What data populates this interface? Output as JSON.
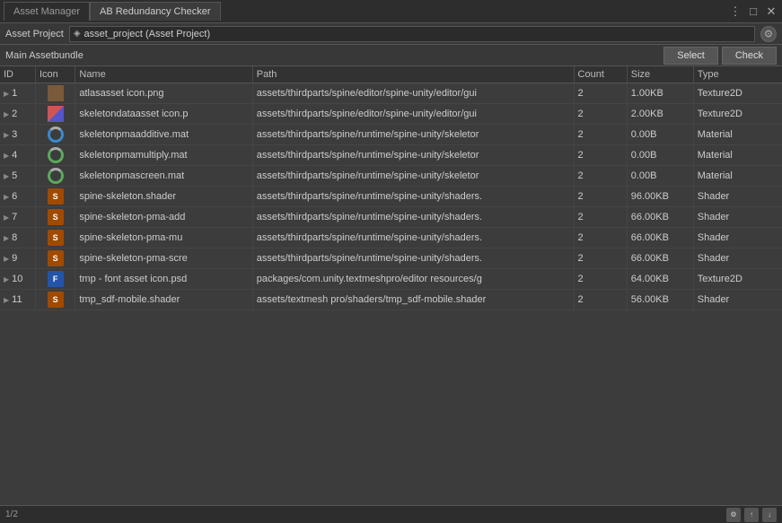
{
  "titleBar": {
    "tabs": [
      {
        "label": "Asset Manager",
        "active": false
      },
      {
        "label": "AB Redundancy Checker",
        "active": true
      }
    ],
    "controls": [
      "⋮",
      "□",
      "✕"
    ]
  },
  "secondBar": {
    "label": "Asset Project",
    "field": "asset_project (Asset Project)",
    "icon": "◈"
  },
  "thirdBar": {
    "label": "Main Assetbundle",
    "selectBtn": "Select",
    "checkBtn": "Check"
  },
  "table": {
    "headers": [
      "ID",
      "Icon",
      "Name",
      "Path",
      "Count",
      "Size",
      "Type"
    ],
    "rows": [
      {
        "id": 1,
        "iconClass": "icon-atlas",
        "iconText": "",
        "name": "atlasasset icon.png",
        "path": "assets/thirdparts/spine/editor/spine-unity/editor/gui",
        "count": 2,
        "size": "1.00KB",
        "type": "Texture2D"
      },
      {
        "id": 2,
        "iconClass": "icon-skeleton",
        "iconText": "",
        "name": "skeletondataasset icon.p",
        "path": "assets/thirdparts/spine/editor/spine-unity/editor/gui",
        "count": 2,
        "size": "2.00KB",
        "type": "Texture2D"
      },
      {
        "id": 3,
        "iconClass": "icon-spinner",
        "iconText": "",
        "name": "skeletonpmaadditive.mat",
        "path": "assets/thirdparts/spine/runtime/spine-unity/skeletor",
        "count": 2,
        "size": "0.00B",
        "type": "Material"
      },
      {
        "id": 4,
        "iconClass": "icon-spinner2",
        "iconText": "",
        "name": "skeletonpmamultiply.mat",
        "path": "assets/thirdparts/spine/runtime/spine-unity/skeletor",
        "count": 2,
        "size": "0.00B",
        "type": "Material"
      },
      {
        "id": 5,
        "iconClass": "icon-spinner2",
        "iconText": "",
        "name": "skeletonpmascreen.mat",
        "path": "assets/thirdparts/spine/runtime/spine-unity/skeletor",
        "count": 2,
        "size": "0.00B",
        "type": "Material"
      },
      {
        "id": 6,
        "iconClass": "icon-s",
        "iconText": "S",
        "name": "spine-skeleton.shader",
        "path": "assets/thirdparts/spine/runtime/spine-unity/shaders.",
        "count": 2,
        "size": "96.00KB",
        "type": "Shader"
      },
      {
        "id": 7,
        "iconClass": "icon-s",
        "iconText": "S",
        "name": "spine-skeleton-pma-add",
        "path": "assets/thirdparts/spine/runtime/spine-unity/shaders.",
        "count": 2,
        "size": "66.00KB",
        "type": "Shader"
      },
      {
        "id": 8,
        "iconClass": "icon-s",
        "iconText": "S",
        "name": "spine-skeleton-pma-mu",
        "path": "assets/thirdparts/spine/runtime/spine-unity/shaders.",
        "count": 2,
        "size": "66.00KB",
        "type": "Shader"
      },
      {
        "id": 9,
        "iconClass": "icon-s",
        "iconText": "S",
        "name": "spine-skeleton-pma-scre",
        "path": "assets/thirdparts/spine/runtime/spine-unity/shaders.",
        "count": 2,
        "size": "66.00KB",
        "type": "Shader"
      },
      {
        "id": 10,
        "iconClass": "icon-f",
        "iconText": "F",
        "name": "tmp - font asset icon.psd",
        "path": "packages/com.unity.textmeshpro/editor resources/g",
        "count": 2,
        "size": "64.00KB",
        "type": "Texture2D"
      },
      {
        "id": 11,
        "iconClass": "icon-s",
        "iconText": "S",
        "name": "tmp_sdf-mobile.shader",
        "path": "assets/textmesh pro/shaders/tmp_sdf-mobile.shader",
        "count": 2,
        "size": "56.00KB",
        "type": "Shader"
      }
    ]
  },
  "bottomBar": {
    "pageNum": "1/2",
    "icons": [
      "⚙",
      "⬆",
      "⬇"
    ]
  }
}
